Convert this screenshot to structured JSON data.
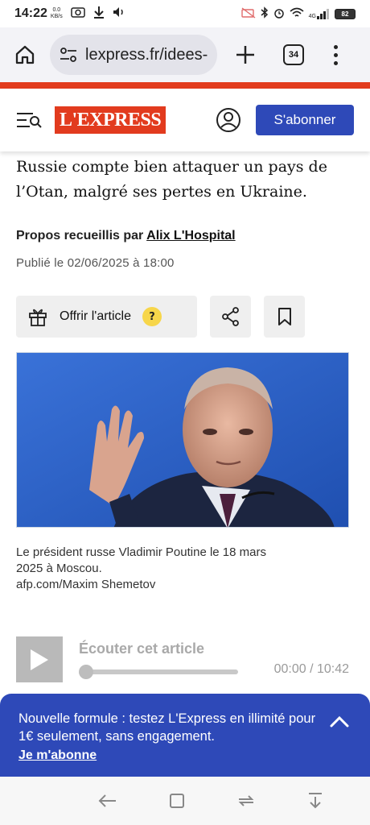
{
  "status_bar": {
    "time": "14:22",
    "net_speed_value": "0.0",
    "net_speed_unit": "KB/s",
    "signal_label": "4G",
    "battery": "82"
  },
  "browser": {
    "url": "lexpress.fr/idees-",
    "tab_count": "34"
  },
  "site_header": {
    "logo_text": "L'EXPRESS",
    "subscribe_label": "S'abonner",
    "brand_color": "#e23b1e",
    "accent_color": "#2e49b8"
  },
  "article": {
    "lead_line1": "Russie compte bien attaquer un pays de",
    "lead_line2": "l’Otan, malgré ses pertes en Ukraine.",
    "byline_prefix": "Propos recueillis par",
    "author": "Alix L'Hospital",
    "published": "Publié le 02/06/2025 à 18:00",
    "offer_label": "Offrir l'article",
    "offer_help": "?",
    "caption_line1": "Le président russe Vladimir Poutine le 18 mars",
    "caption_line2": "2025 à Moscou.",
    "credit": "afp.com/Maxim Shemetov"
  },
  "audio_player": {
    "title": "Écouter cet article",
    "time": "00:00 / 10:42",
    "progress": 0
  },
  "promo": {
    "text": "Nouvelle formule : testez L'Express en illimité pour 1€ seulement, sans engagement.",
    "cta": "Je m'abonne"
  }
}
